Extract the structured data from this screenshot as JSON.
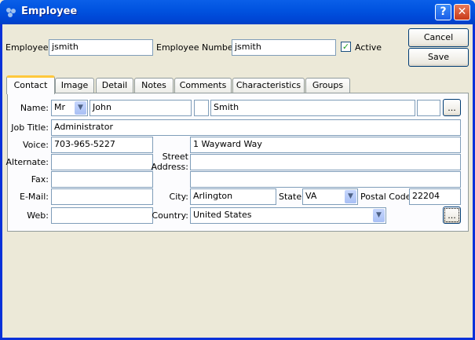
{
  "window": {
    "title": "Employee",
    "help": "?",
    "close": "✕"
  },
  "header": {
    "employee_label": "Employee:",
    "employee_value": "jsmith",
    "number_label": "Employee Number:",
    "number_value": "jsmith",
    "active_label": "Active",
    "active_checked": true,
    "cancel": "Cancel",
    "save": "Save"
  },
  "tabs": [
    "Contact",
    "Image",
    "Detail",
    "Notes",
    "Comments",
    "Characteristics",
    "Groups"
  ],
  "contact": {
    "name_label": "Name:",
    "honorific": "Mr",
    "first": "John",
    "middle": "",
    "last": "Smith",
    "suffix": "",
    "more": "...",
    "job_title_label": "Job Title:",
    "job_title": "Administrator",
    "voice_label": "Voice:",
    "voice": "703-965-5227",
    "alternate_label": "Alternate:",
    "alternate": "",
    "fax_label": "Fax:",
    "fax": "",
    "email_label": "E-Mail:",
    "email": "",
    "web_label": "Web:",
    "web": "",
    "street_label_1": "Street",
    "street_label_2": "Address:",
    "street1": "1 Wayward Way",
    "street2": "",
    "street3": "",
    "city_label": "City:",
    "city": "Arlington",
    "state_label": "State:",
    "state": "VA",
    "postal_label": "Postal Code:",
    "postal": "22204",
    "country_label": "Country:",
    "country": "United States",
    "address_more": "..."
  }
}
